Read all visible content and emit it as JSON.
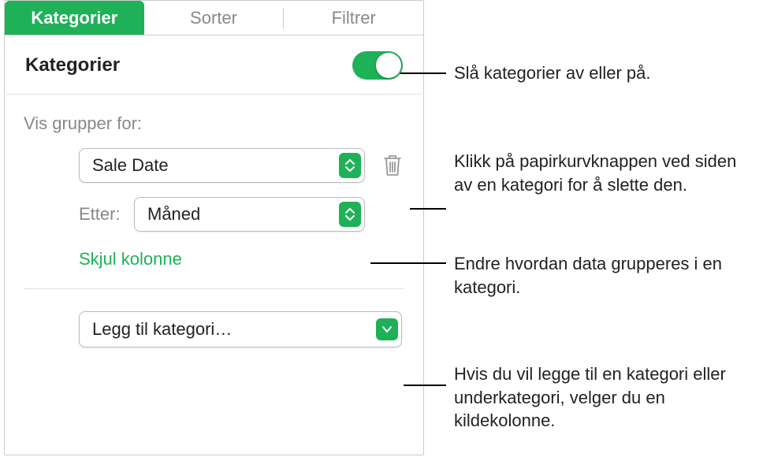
{
  "tabs": {
    "active": "Kategorier",
    "items": [
      "Kategorier",
      "Sorter",
      "Filtrer"
    ]
  },
  "section": {
    "title": "Kategorier"
  },
  "groups": {
    "label": "Vis grupper for:",
    "category_value": "Sale Date",
    "by_label": "Etter:",
    "by_value": "Måned",
    "hide_column": "Skjul kolonne"
  },
  "add_category": {
    "label": "Legg til kategori…"
  },
  "callouts": {
    "toggle": "Slå kategorier av eller på.",
    "trash": "Klikk på papirkurvknappen ved siden av en kategori for å slette den.",
    "grouping": "Endre hvordan data grupperes i en kategori.",
    "add": "Hvis du vil legge til en kategori eller underkategori, velger du en kildekolonne."
  }
}
